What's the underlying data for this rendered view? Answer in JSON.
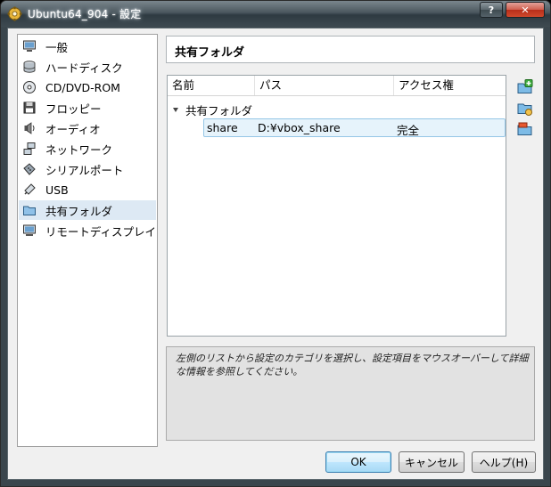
{
  "window": {
    "title": "Ubuntu64_904 - 設定",
    "help_label": "?",
    "close_label": "✕"
  },
  "sidebar": {
    "items": [
      {
        "label": "一般",
        "icon": "monitor-icon"
      },
      {
        "label": "ハードディスク",
        "icon": "hard-disk-icon"
      },
      {
        "label": "CD/DVD-ROM",
        "icon": "cd-dvd-icon"
      },
      {
        "label": "フロッピー",
        "icon": "floppy-icon"
      },
      {
        "label": "オーディオ",
        "icon": "audio-icon"
      },
      {
        "label": "ネットワーク",
        "icon": "network-icon"
      },
      {
        "label": "シリアルポート",
        "icon": "serial-port-icon"
      },
      {
        "label": "USB",
        "icon": "usb-icon"
      },
      {
        "label": "共有フォルダ",
        "icon": "shared-folder-icon",
        "selected": true
      },
      {
        "label": "リモートディスプレイ",
        "icon": "remote-display-icon"
      }
    ]
  },
  "panel": {
    "title": "共有フォルダ"
  },
  "table": {
    "columns": [
      "名前",
      "パス",
      "アクセス権"
    ],
    "group_label": "共有フォルダ",
    "rows": [
      {
        "name": "share",
        "path": "D:¥vbox_share",
        "access": "完全"
      }
    ]
  },
  "toolbar": {
    "add_icon": "add-shared-folder-icon",
    "edit_icon": "edit-shared-folder-icon",
    "remove_icon": "remove-shared-folder-icon"
  },
  "info": {
    "text": "左側のリストから設定のカテゴリを選択し、設定項目をマウスオーバーして詳細な情報を参照してください。"
  },
  "buttons": {
    "ok": "OK",
    "cancel": "キャンセル",
    "help": "ヘルプ(H)"
  },
  "colors": {
    "selection": "#dde9f4",
    "row_highlight": "#e6f3fb",
    "accent": "#3c7fb1"
  }
}
